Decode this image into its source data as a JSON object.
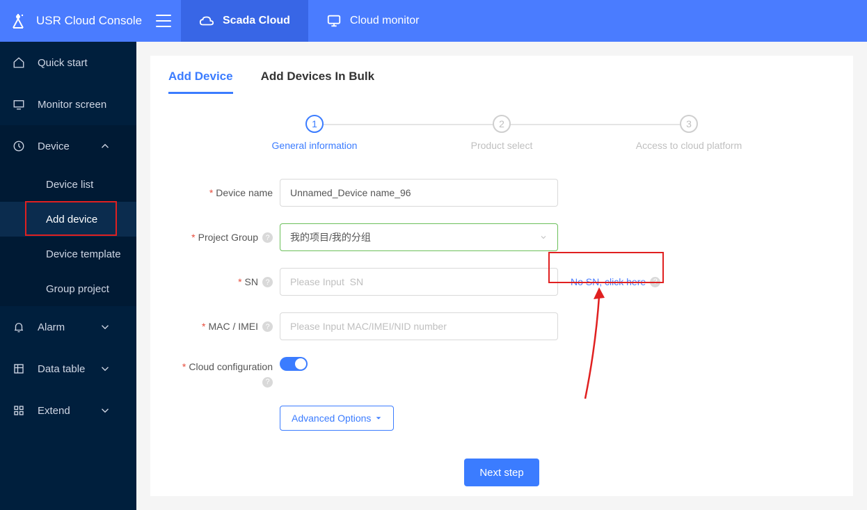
{
  "header": {
    "app_title": "USR Cloud Console",
    "tabs": [
      {
        "label": "Scada Cloud",
        "active": true
      },
      {
        "label": "Cloud monitor",
        "active": false
      }
    ]
  },
  "sidebar": {
    "quick_start": "Quick start",
    "monitor_screen": "Monitor screen",
    "device": "Device",
    "device_sub": {
      "device_list": "Device list",
      "add_device": "Add device",
      "device_template": "Device template",
      "group_project": "Group project"
    },
    "alarm": "Alarm",
    "data_table": "Data table",
    "extend": "Extend"
  },
  "tabs": {
    "add_device": "Add Device",
    "add_bulk": "Add Devices In Bulk"
  },
  "steps": {
    "s1": {
      "num": "1",
      "label": "General information"
    },
    "s2": {
      "num": "2",
      "label": "Product select"
    },
    "s3": {
      "num": "3",
      "label": "Access to cloud platform"
    }
  },
  "form": {
    "device_name_label": "Device name",
    "device_name_value": "Unnamed_Device name_96",
    "project_group_label": "Project Group",
    "project_group_value": "我的项目/我的分组",
    "sn_label": "SN",
    "sn_placeholder": "Please Input  SN",
    "no_sn_link": "No SN, click here",
    "mac_label": "MAC / IMEI",
    "mac_placeholder": "Please Input MAC/IMEI/NID number",
    "cloud_config_label": "Cloud configuration",
    "cloud_config_on": true,
    "advanced_options": "Advanced Options",
    "next_step": "Next step"
  }
}
